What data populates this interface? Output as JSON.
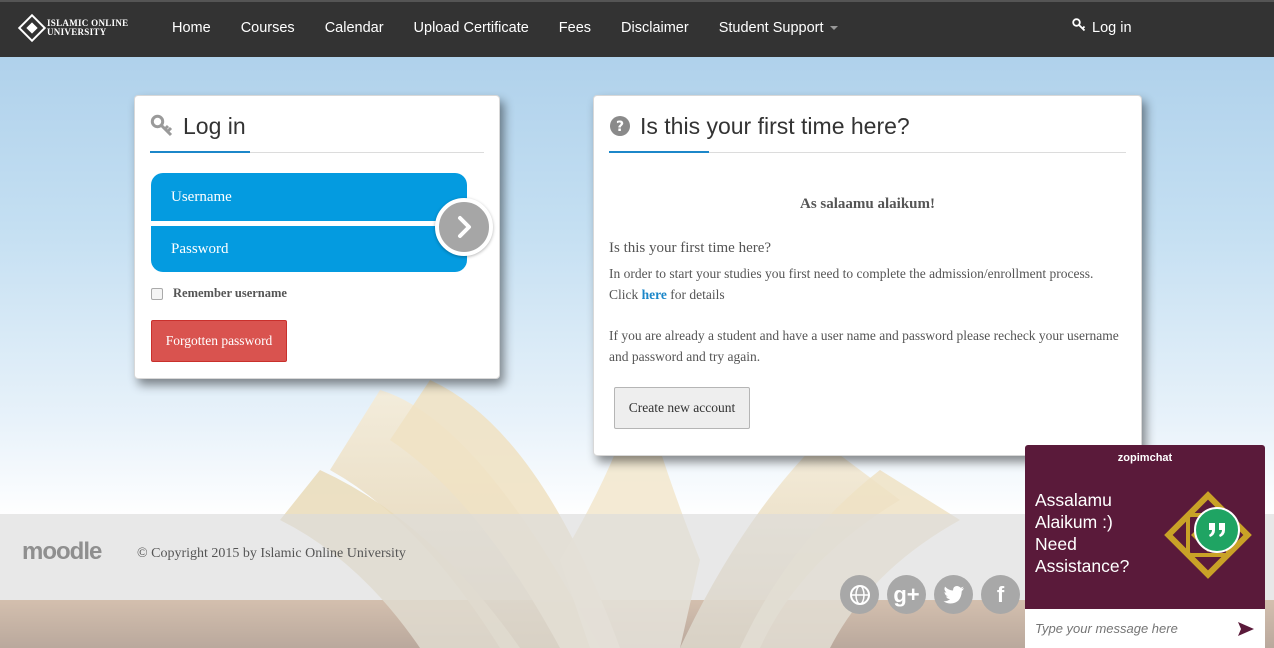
{
  "navbar": {
    "brand_line1": "Islamic Online",
    "brand_line2": "University",
    "items": [
      {
        "label": "Home"
      },
      {
        "label": "Courses"
      },
      {
        "label": "Calendar"
      },
      {
        "label": "Upload Certificate"
      },
      {
        "label": "Fees"
      },
      {
        "label": "Disclaimer"
      },
      {
        "label": "Student Support"
      }
    ],
    "login_label": "Log in"
  },
  "login_panel": {
    "title": "Log in",
    "username_label": "Username",
    "password_label": "Password",
    "remember_label": "Remember username",
    "forgot_label": "Forgotten password"
  },
  "first_panel": {
    "title": "Is this your first time here?",
    "greeting": "As salaamu alaikum!",
    "question": "Is this your first time here?",
    "para1_text": "In order to start your studies you first need to complete the admission/enrollment process.",
    "click_word": "Click",
    "link_label": "here",
    "details_text": "for details",
    "para2": "If you are already a student and have a user name and password please recheck your username and password and try again.",
    "create_label": "Create new account"
  },
  "footer": {
    "moodle_logo": "moodle",
    "copyright": "© Copyright 2015 by Islamic Online University",
    "social": [
      {
        "icon": "globe-icon",
        "glyph": ""
      },
      {
        "icon": "google-plus-icon",
        "glyph": "g+"
      },
      {
        "icon": "twitter-icon",
        "glyph": ""
      },
      {
        "icon": "facebook-icon",
        "glyph": "f"
      }
    ]
  },
  "chat": {
    "brand": "zopimchat",
    "message": "Assalamu Alaikum :) Need Assistance?",
    "input_placeholder": "Type your message here"
  },
  "colors": {
    "navbar": "#333333",
    "accent_blue": "#049be0",
    "danger": "#d9534f",
    "chat_bg": "#5a1a3a",
    "chat_bubble": "#1fa463"
  }
}
